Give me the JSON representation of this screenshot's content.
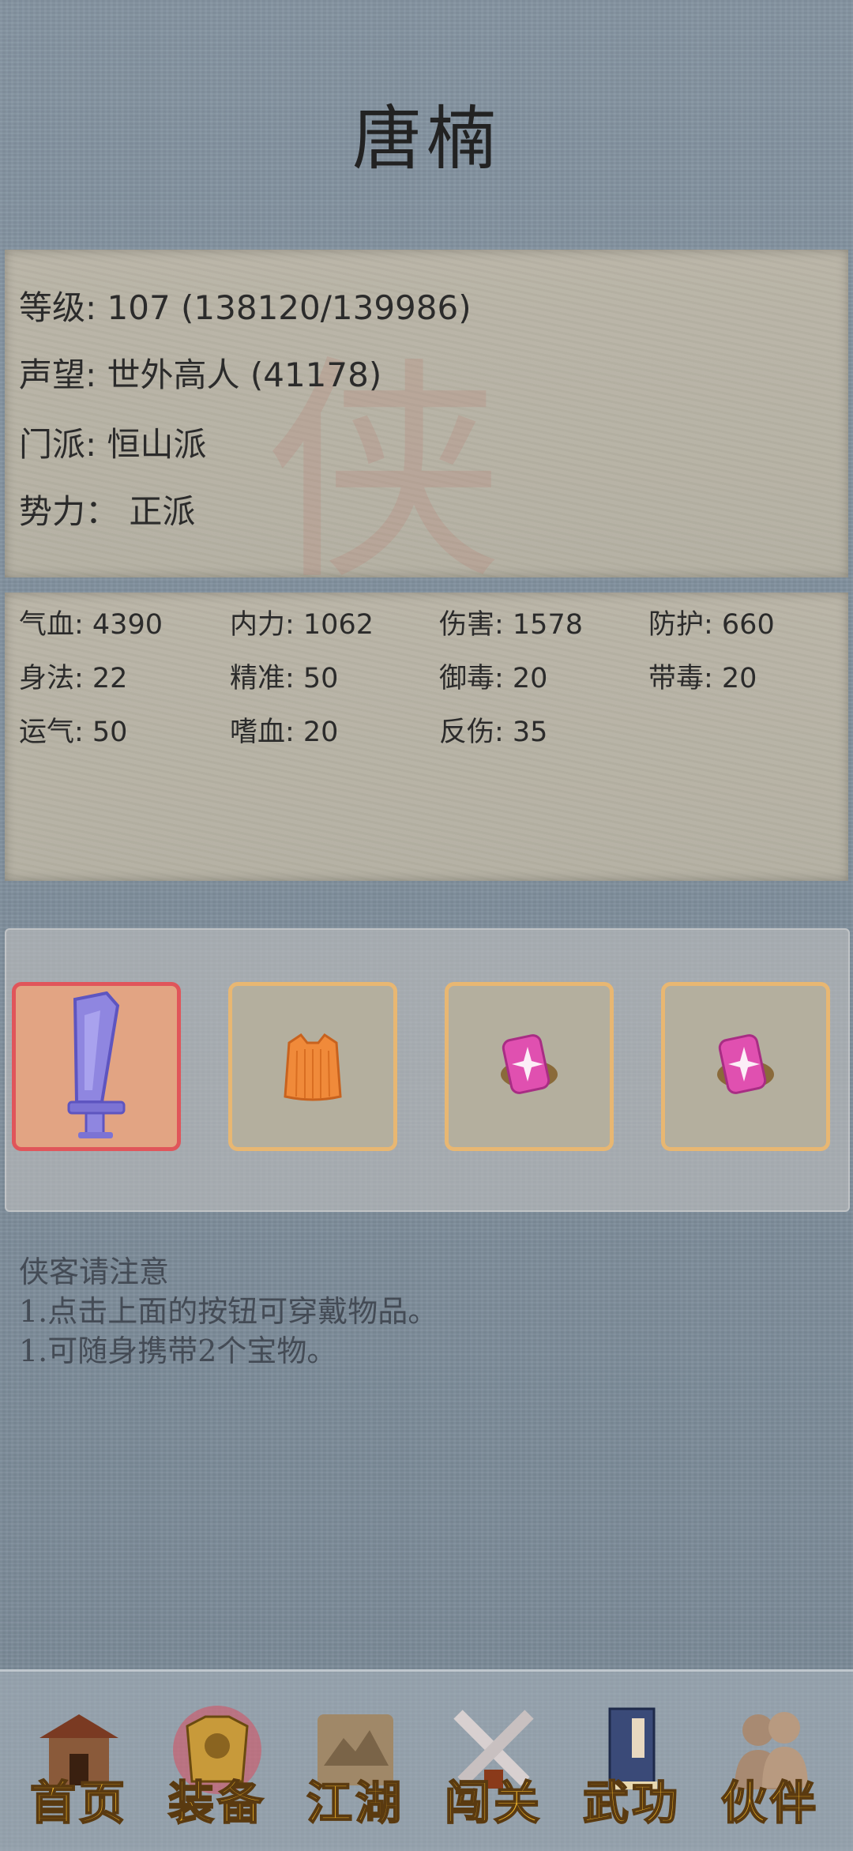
{
  "character": {
    "name": "唐楠"
  },
  "info": {
    "level": "等级: 107 (138120/139986)",
    "reputation": "声望: 世外高人 (41178)",
    "sect": "门派: 恒山派",
    "faction": "势力： 正派"
  },
  "stats": [
    {
      "label": "气血: 4390"
    },
    {
      "label": "内力: 1062"
    },
    {
      "label": "伤害: 1578"
    },
    {
      "label": "防护: 660"
    },
    {
      "label": "身法: 22"
    },
    {
      "label": "精准: 50"
    },
    {
      "label": "御毒: 20"
    },
    {
      "label": "带毒: 20"
    },
    {
      "label": "运气: 50"
    },
    {
      "label": "嗜血: 20"
    },
    {
      "label": "反伤: 35"
    }
  ],
  "equipment": [
    {
      "name": "sword-icon",
      "selected": true
    },
    {
      "name": "vest-icon",
      "selected": false
    },
    {
      "name": "gem-icon",
      "selected": false
    },
    {
      "name": "gem-icon",
      "selected": false
    }
  ],
  "notes": {
    "line1": "侠客请注意",
    "line2": "1.点击上面的按钮可穿戴物品。",
    "line3": "1.可随身携带2个宝物。"
  },
  "nav": [
    {
      "label": "首页",
      "icon": "house-icon"
    },
    {
      "label": "装备",
      "icon": "armor-icon"
    },
    {
      "label": "江湖",
      "icon": "scroll-map-icon"
    },
    {
      "label": "闯关",
      "icon": "crossed-swords-icon"
    },
    {
      "label": "武功",
      "icon": "book-icon"
    },
    {
      "label": "伙伴",
      "icon": "companions-icon"
    }
  ],
  "colors": {
    "background": "#7f8e9c",
    "panel": "#b7b2a4",
    "slot_border": "#e8b772",
    "slot_selected_border": "#e0555a",
    "nav_label": "#f0b62b"
  }
}
